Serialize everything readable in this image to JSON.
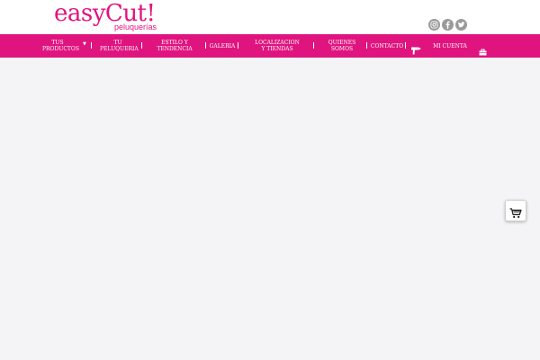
{
  "brand": {
    "logo_main": "easyCut!",
    "logo_sub": "peluquerías",
    "color": "#e0147f"
  },
  "socials": [
    {
      "icon": "instagram-icon"
    },
    {
      "icon": "facebook-icon"
    },
    {
      "icon": "twitter-icon"
    }
  ],
  "nav": {
    "items": [
      {
        "label": "TUS PRODUCTOS"
      },
      {
        "label": "TU PELUQUERIA"
      },
      {
        "label": "ESTILO Y TENDENCIA"
      },
      {
        "label": "GALERIA"
      },
      {
        "label": "LOCALIZACION Y TIENDAS"
      },
      {
        "label": "QUIENES SOMOS"
      },
      {
        "label": "CONTACTO"
      },
      {
        "label": "MI CUENTA"
      }
    ],
    "icons": [
      "hairdryer-icon",
      "account-icon"
    ]
  },
  "floating": {
    "cart_icon": "shopping-cart-icon"
  }
}
